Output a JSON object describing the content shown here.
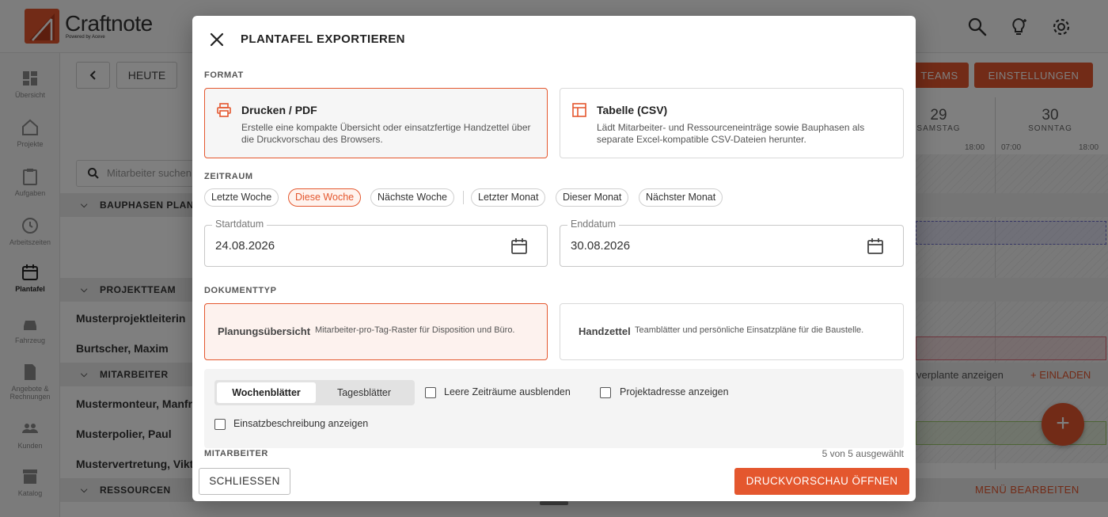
{
  "app": {
    "logo_name": "Craftnote",
    "logo_sub": "Powered by Aceve",
    "sidebar": [
      {
        "label": "Übersicht",
        "icon": "dashboard-icon"
      },
      {
        "label": "Projekte",
        "icon": "house-icon"
      },
      {
        "label": "Aufgaben",
        "icon": "clipboard-icon"
      },
      {
        "label": "Arbeitszeiten",
        "icon": "clock-icon"
      },
      {
        "label": "Plantafel",
        "icon": "calendar-icon",
        "active": true
      },
      {
        "label": "Fahrzeug",
        "icon": "car-icon"
      },
      {
        "label": "Angebote & Rechnungen",
        "icon": "document-euro-icon"
      },
      {
        "label": "Kunden",
        "icon": "people-icon"
      },
      {
        "label": "Katalog",
        "icon": "archive-icon"
      }
    ],
    "toolbar": {
      "today": "HEUTE",
      "teams": "TEAMS",
      "settings": "EINSTELLUNGEN"
    },
    "search_placeholder": "Mitarbeiter suchen",
    "sections": {
      "bauphasen": "BAUPHASEN PLANEN",
      "projektteam": "PROJEKTTEAM",
      "mitarbeiter": "MITARBEITER",
      "ressourcen": "RESSOURCEN"
    },
    "people": [
      "Musterprojektleiterin",
      "Burtscher, Maxim",
      "Mustermonteur, Manfred",
      "Musterpolier, Paul",
      "Mustervertretung, Viktoria"
    ],
    "calendar": {
      "days": [
        {
          "num": "29",
          "name": "SAMSTAG"
        },
        {
          "num": "30",
          "name": "SONNTAG"
        }
      ],
      "times": [
        "18:00",
        "07:00",
        "18:00"
      ]
    },
    "unplanned": "verplante anzeigen",
    "invite": "+ EINLADEN",
    "edit_menu": "MENÜ BEARBEITEN"
  },
  "modal": {
    "title": "PLANTAFEL EXPORTIEREN",
    "format_label": "FORMAT",
    "formats": [
      {
        "title": "Drucken / PDF",
        "desc": "Erstelle eine kompakte Übersicht oder einsatzfertige Handzettel über die Druckvorschau des Browsers.",
        "selected": true
      },
      {
        "title": "Tabelle (CSV)",
        "desc": "Lädt Mitarbeiter- und Ressourceneinträge sowie Bauphasen als separate Excel-kompatible CSV-Dateien herunter.",
        "selected": false
      }
    ],
    "period_label": "ZEITRAUM",
    "periods": [
      "Letzte Woche",
      "Diese Woche",
      "Nächste Woche",
      "Letzter Monat",
      "Dieser Monat",
      "Nächster Monat"
    ],
    "period_selected": "Diese Woche",
    "start": {
      "label": "Startdatum",
      "value": "24.08.2026"
    },
    "end": {
      "label": "Enddatum",
      "value": "30.08.2026"
    },
    "doctype_label": "DOKUMENTTYP",
    "doctypes": [
      {
        "title": "Planungsübersicht",
        "desc": "Mitarbeiter-pro-Tag-Raster für Disposition und Büro.",
        "selected": true
      },
      {
        "title": "Handzettel",
        "desc": "Teamblätter und persönliche Einsatzpläne für die Baustelle.",
        "selected": false
      }
    ],
    "segments": [
      "Wochenblätter",
      "Tagesblätter"
    ],
    "segment_selected": "Wochenblätter",
    "options": {
      "hide_empty": "Leere Zeiträume ausblenden",
      "show_address": "Projektadresse anzeigen",
      "show_description": "Einsatzbeschreibung anzeigen"
    },
    "employees_label": "MITARBEITER",
    "employees_count": "5 von 5 ausgewählt",
    "close_button": "SCHLIESSEN",
    "print_button": "DRUCKVORSCHAU ÖFFNEN",
    "accent_color": "#e4572e"
  }
}
